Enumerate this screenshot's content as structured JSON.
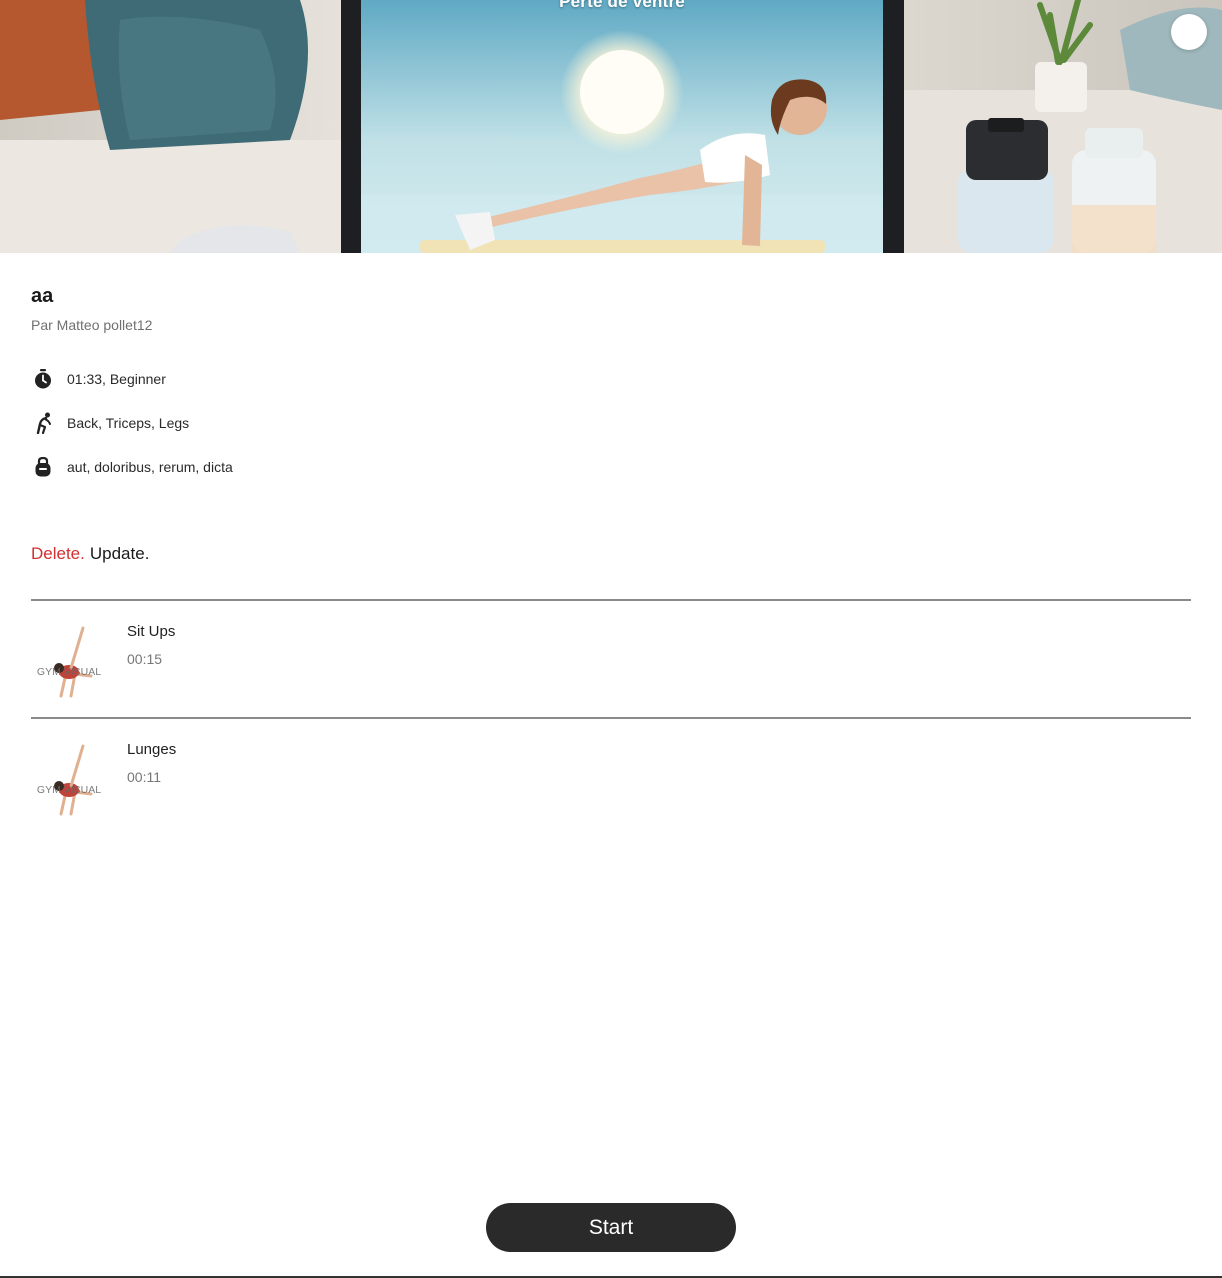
{
  "hero": {
    "image_name": "workout-cover-plank-illustration",
    "overlay_title": "Perte de ventre",
    "favorite_icon": "heart-outline-icon"
  },
  "workout": {
    "title": "aa",
    "author": "Par Matteo pollet12",
    "duration_level": "01:33, Beginner",
    "muscles": "Back, Triceps, Legs",
    "equipment": "aut, doloribus, rerum, dicta"
  },
  "icons": {
    "duration": "stopwatch-icon",
    "muscles": "stretching-figure-icon",
    "equipment": "kettlebell-icon"
  },
  "actions": {
    "delete_label": "Delete.",
    "update_label": "Update."
  },
  "exercises": [
    {
      "name": "Sit Ups",
      "duration": "00:15",
      "thumb_text": "GYM VISUAL"
    },
    {
      "name": "Lunges",
      "duration": "00:11",
      "thumb_text": "GYM VISUAL"
    }
  ],
  "start_label": "Start",
  "colors": {
    "delete": "#d03131",
    "button_bg": "#2a2a2a",
    "divider": "#8a8a8a"
  }
}
